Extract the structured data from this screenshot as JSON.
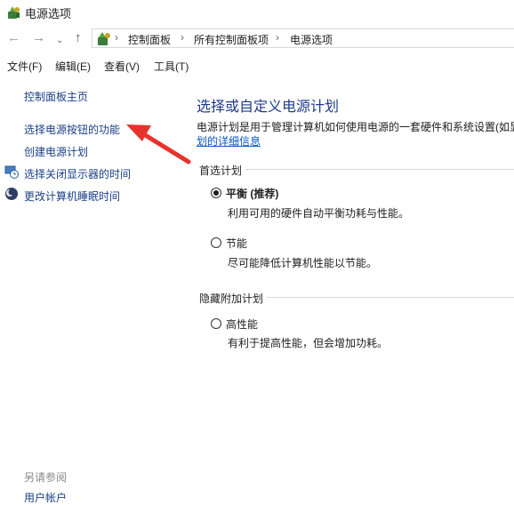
{
  "window": {
    "title": "电源选项"
  },
  "nav": {
    "back": "←",
    "forward": "→",
    "recent": "⌄",
    "up": "↑",
    "breadcrumbs": [
      "控制面板",
      "所有控制面板项",
      "电源选项"
    ],
    "separator": "›"
  },
  "menu": {
    "items": [
      "文件(F)",
      "编辑(E)",
      "查看(V)",
      "工具(T)"
    ]
  },
  "sidebar": {
    "home": "控制面板主页",
    "links": [
      "选择电源按钮的功能",
      "创建电源计划",
      "选择关闭显示器的时间",
      "更改计算机睡眠时间"
    ],
    "see_also": "另请参阅",
    "user_accounts": "用户帐户"
  },
  "main": {
    "heading": "选择或自定义电源计划",
    "description": "电源计划是用于管理计算机如何使用电源的一套硬件和系统设置(如显",
    "description_link": "划的详细信息",
    "preferred_label": "首选计划",
    "hidden_label": "隐藏附加计划",
    "plans": [
      {
        "name": "平衡 (推荐)",
        "desc": "利用可用的硬件自动平衡功耗与性能。",
        "selected": true
      },
      {
        "name": "节能",
        "desc": "尽可能降低计算机性能以节能。",
        "selected": false
      },
      {
        "name": "高性能",
        "desc": "有利于提高性能，但会增加功耗。",
        "selected": false
      }
    ]
  },
  "annotation": {
    "arrow_color": "#e8322d"
  }
}
